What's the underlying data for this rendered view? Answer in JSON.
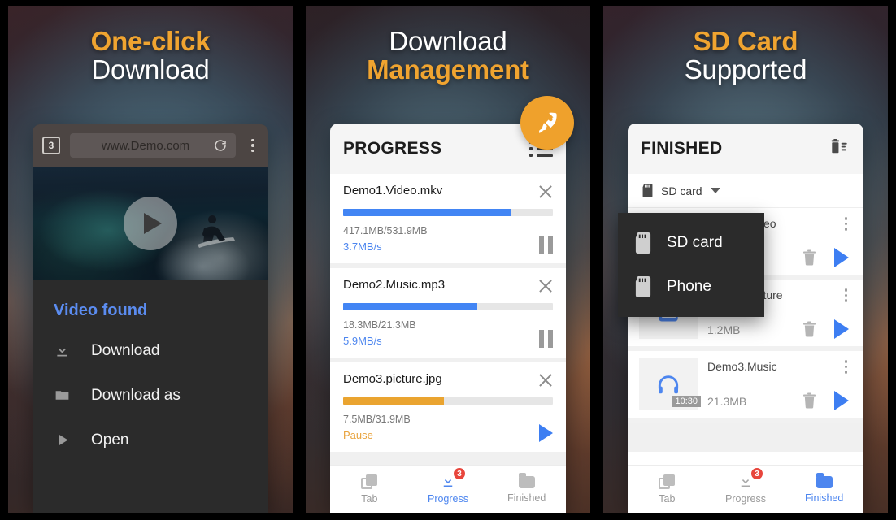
{
  "panels": [
    {
      "headline": {
        "line1": "One-click",
        "line1_style": "accent",
        "line2": "Download",
        "line2_style": "plain"
      },
      "browser": {
        "tab_count": "3",
        "url": "www.Demo.com",
        "reload_icon": "reload-icon",
        "menu_icon": "kebab-menu-icon",
        "video_play_icon": "play-icon"
      },
      "sheet": {
        "title": "Video found",
        "items": [
          {
            "label": "Download",
            "icon": "download-icon"
          },
          {
            "label": "Download as",
            "icon": "folder-icon"
          },
          {
            "label": "Open",
            "icon": "play-triangle-icon"
          }
        ]
      }
    },
    {
      "headline": {
        "line1": "Download",
        "line1_style": "plain",
        "line2": "Management",
        "line2_style": "accent"
      },
      "fab": {
        "icon": "rocket-icon"
      },
      "header": {
        "title": "PROGRESS",
        "action_icon": "list-view-icon"
      },
      "downloads": [
        {
          "name": "Demo1.Video.mkv",
          "size": "417.1MB/531.9MB",
          "status": "3.7MB/s",
          "status_color": "#4d86ef",
          "percent": 80,
          "bar_color": "#4285f4",
          "action_icon": "pause-icon",
          "close_icon": "close-icon"
        },
        {
          "name": "Demo2.Music.mp3",
          "size": "18.3MB/21.3MB",
          "status": "5.9MB/s",
          "status_color": "#4d86ef",
          "percent": 64,
          "bar_color": "#4285f4",
          "action_icon": "pause-icon",
          "close_icon": "close-icon"
        },
        {
          "name": "Demo3.picture.jpg",
          "size": "7.5MB/31.9MB",
          "status": "Pause",
          "status_color": "#e8a33d",
          "percent": 48,
          "bar_color": "#eaa430",
          "action_icon": "play-icon",
          "close_icon": "close-icon"
        }
      ],
      "bottom_nav": [
        {
          "label": "Tab",
          "icon": "tabs-icon",
          "active": false,
          "badge": ""
        },
        {
          "label": "Progress",
          "icon": "download-arrow-icon",
          "active": true,
          "badge": "3"
        },
        {
          "label": "Finished",
          "icon": "folder-icon",
          "active": false,
          "badge": ""
        }
      ]
    },
    {
      "headline": {
        "line1": "SD Card",
        "line1_style": "accent",
        "line2": "Supported",
        "line2_style": "plain"
      },
      "header": {
        "title": "FINISHED",
        "action_icon": "delete-list-icon"
      },
      "storage": {
        "label": "SD card",
        "icon": "sd-card-icon",
        "caret_icon": "chevron-down-icon"
      },
      "dropdown": {
        "options": [
          {
            "label": "SD card",
            "icon": "sd-card-icon"
          },
          {
            "label": "Phone",
            "icon": "sd-card-icon"
          }
        ]
      },
      "finished": [
        {
          "name": "Demo1.Video",
          "size": "",
          "duration": "",
          "thumb_icon": "video-icon",
          "menu_icon": "kebab-menu-icon",
          "delete_icon": "trash-icon",
          "play_icon": "play-icon"
        },
        {
          "name": "Demo2.Picture",
          "size": "1.2MB",
          "duration": "",
          "thumb_icon": "image-icon",
          "menu_icon": "kebab-menu-icon",
          "delete_icon": "trash-icon",
          "play_icon": "play-icon"
        },
        {
          "name": "Demo3.Music",
          "size": "21.3MB",
          "duration": "10:30",
          "thumb_icon": "headphones-icon",
          "menu_icon": "kebab-menu-icon",
          "delete_icon": "trash-icon",
          "play_icon": "play-icon"
        }
      ],
      "bottom_nav": [
        {
          "label": "Tab",
          "icon": "tabs-icon",
          "active": false,
          "badge": ""
        },
        {
          "label": "Progress",
          "icon": "download-arrow-icon",
          "active": false,
          "badge": "3"
        },
        {
          "label": "Finished",
          "icon": "folder-icon",
          "active": true,
          "badge": ""
        }
      ]
    }
  ],
  "colors": {
    "accent": "#f0a430",
    "blue": "#4285f4",
    "orange_bar": "#eaa430",
    "badge_red": "#e8453c"
  }
}
